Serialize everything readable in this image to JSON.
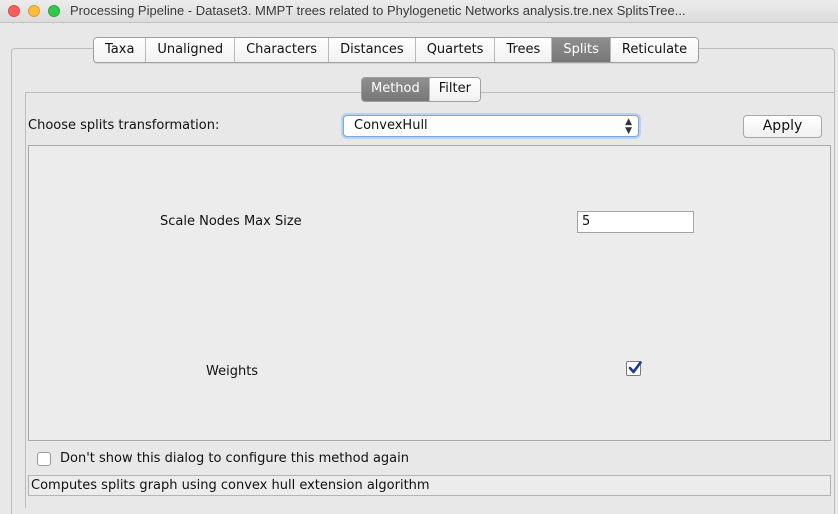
{
  "window": {
    "title": "Processing Pipeline - Dataset3. MMPT trees related to Phylogenetic Networks analysis.tre.nex SplitsTree..."
  },
  "tabs": [
    {
      "label": "Taxa",
      "active": false
    },
    {
      "label": "Unaligned",
      "active": false
    },
    {
      "label": "Characters",
      "active": false
    },
    {
      "label": "Distances",
      "active": false
    },
    {
      "label": "Quartets",
      "active": false
    },
    {
      "label": "Trees",
      "active": false
    },
    {
      "label": "Splits",
      "active": true
    },
    {
      "label": "Reticulate",
      "active": false
    }
  ],
  "subtabs": [
    {
      "label": "Method",
      "active": true
    },
    {
      "label": "Filter",
      "active": false
    }
  ],
  "method": {
    "choose_label": "Choose splits transformation:",
    "selected_transformation": "ConvexHull",
    "select_icon": "up-down-chevron-icon",
    "apply_label": "Apply"
  },
  "parameters": {
    "scale_nodes_label": "Scale Nodes Max Size",
    "scale_nodes_value": "5",
    "weights_label": "Weights",
    "weights_checked": true
  },
  "footer": {
    "dont_show_label": "Don't show this dialog to configure this method again",
    "dont_show_checked": false,
    "description": "Computes splits graph using convex hull extension algorithm"
  },
  "colors": {
    "close": "#fc605c",
    "minimize": "#fdbc40",
    "zoom": "#34c84a",
    "active_tab": "#808080",
    "focus_ring": "#7aa7e0"
  }
}
